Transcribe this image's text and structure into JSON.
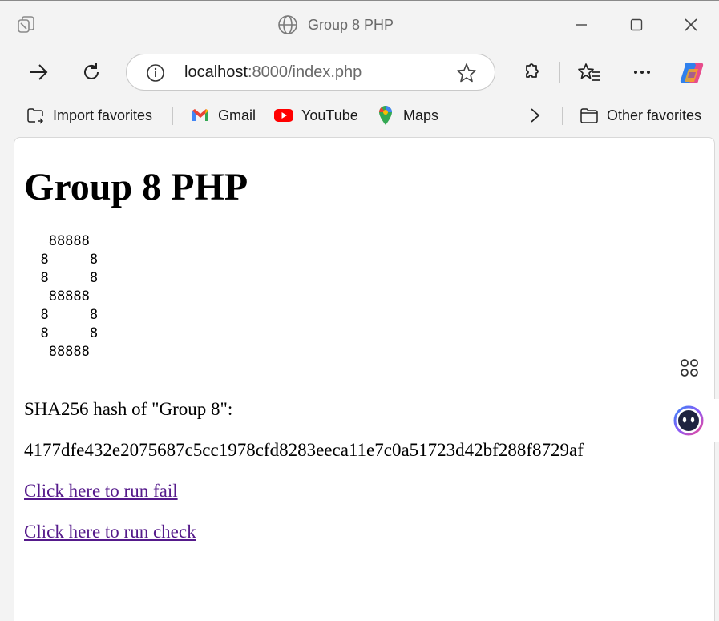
{
  "window": {
    "title": "Group 8 PHP",
    "icons": [
      "tabs-icon",
      "globe-icon",
      "minimize-icon",
      "maximize-icon",
      "close-icon"
    ]
  },
  "toolbar": {
    "url_host": "localhost",
    "url_rest": ":8000/index.php",
    "icons": [
      "forward-icon",
      "refresh-icon",
      "info-icon",
      "favorite-star-icon",
      "extensions-icon",
      "favorites-icon",
      "more-icon",
      "copilot-icon"
    ]
  },
  "favorites": {
    "items": [
      {
        "label": "Import favorites",
        "icon": "import-favorites-icon"
      },
      {
        "label": "Gmail",
        "icon": "gmail-icon"
      },
      {
        "label": "YouTube",
        "icon": "youtube-icon"
      },
      {
        "label": "Maps",
        "icon": "maps-icon"
      }
    ],
    "other_label": "Other favorites"
  },
  "content": {
    "heading": "Group 8 PHP",
    "ascii_art": "   88888\n  8     8\n  8     8\n   88888\n  8     8\n  8     8\n   88888",
    "hash_label": "SHA256 hash of \"Group 8\":",
    "hash_value": "4177dfe432e2075687c5cc1978cfd8283eeca11e7c0a51723d42bf288f8729af",
    "link_fail": "Click here to run fail",
    "link_check": "Click here to run check"
  },
  "colors": {
    "chrome_bg": "#f3f3f3",
    "page_bg": "#ffffff",
    "visited_link": "#551a8b",
    "youtube_red": "#ff0000"
  }
}
